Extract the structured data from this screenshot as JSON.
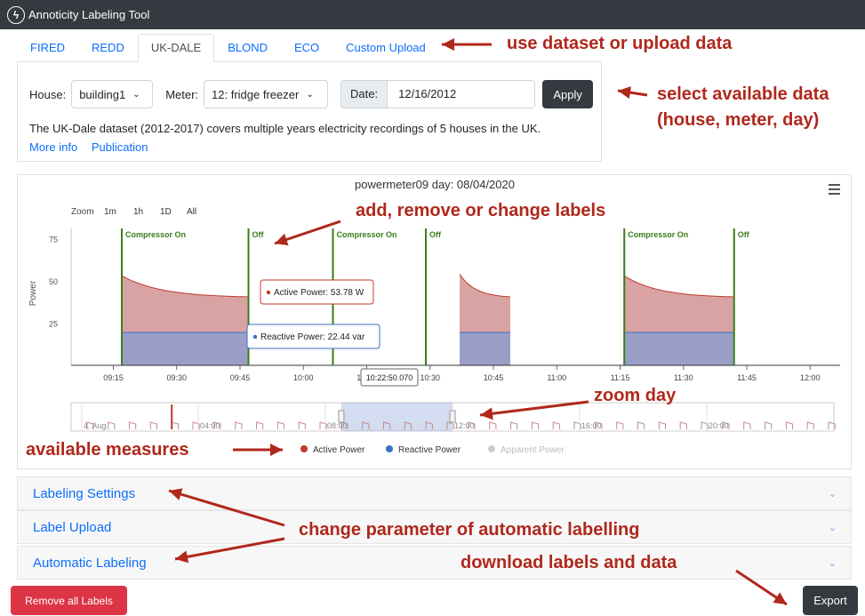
{
  "app": {
    "title": "Annoticity Labeling Tool"
  },
  "tabs": [
    "FIRED",
    "REDD",
    "UK-DALE",
    "BLOND",
    "ECO",
    "Custom Upload"
  ],
  "form": {
    "house_label": "House:",
    "house_value": "building1",
    "meter_label": "Meter:",
    "meter_value": "12: fridge freezer",
    "date_label": "Date:",
    "date_value": "12/16/2012",
    "apply": "Apply",
    "description": "The UK-Dale dataset (2012-2017) covers multiple years electricity recordings of 5 houses in the UK.",
    "more_info": "More info",
    "publication": "Publication"
  },
  "chart_data": {
    "type": "area",
    "title": "powermeter09 day: 08/04/2020",
    "ylabel": "Power",
    "yticks": [
      25,
      50,
      75
    ],
    "ylim": [
      0,
      100
    ],
    "xlim": [
      "09:05",
      "12:05"
    ],
    "xticks": [
      "09:15",
      "09:30",
      "09:45",
      "10:00",
      "10:15",
      "10:30",
      "10:45",
      "11:00",
      "11:15",
      "11:30",
      "11:45",
      "12:00"
    ],
    "zoom_label": "Zoom",
    "zoom_options": [
      "1m",
      "1h",
      "1D",
      "All"
    ],
    "series": [
      {
        "name": "Active Power",
        "color": "#c0392b",
        "fill": "#d9a3a3",
        "unit": "W"
      },
      {
        "name": "Reactive Power",
        "color": "#3b6fc4",
        "fill": "#9a9ec7",
        "unit": "var"
      },
      {
        "name": "Apparent Power",
        "color": "#cccccc",
        "fill": "none",
        "unit": "",
        "disabled": true
      }
    ],
    "cycles": [
      {
        "start": "09:17",
        "end": "09:47",
        "active_peak": 53,
        "active_end": 40,
        "reactive": 19.5
      },
      {
        "start": "10:37",
        "end": "10:49",
        "active_peak": 54,
        "active_end": 40,
        "reactive": 19.5
      },
      {
        "start": "11:16",
        "end": "11:42",
        "active_peak": 53,
        "active_end": 40,
        "reactive": 19.5
      }
    ],
    "labels": [
      {
        "time": "09:17",
        "text": "Compressor On"
      },
      {
        "time": "09:47",
        "text": "Off"
      },
      {
        "time": "10:07",
        "text": "Compressor On"
      },
      {
        "time": "10:29",
        "text": "Off"
      },
      {
        "time": "11:16",
        "text": "Compressor On"
      },
      {
        "time": "11:42",
        "text": "Off"
      }
    ],
    "tooltip_active": "Active Power: 53.78 W",
    "tooltip_reactive": "Reactive Power: 22.44 var",
    "crosshair_time": "10:22:50.070",
    "navigator": {
      "ticks": [
        "4. Aug",
        "04:00",
        "08:00",
        "12:00",
        "16:00",
        "20:00"
      ],
      "selection": [
        "08:30",
        "12:00"
      ]
    },
    "legend_position": "bottom-center"
  },
  "accordion": [
    "Labeling Settings",
    "Label Upload",
    "Automatic Labeling"
  ],
  "buttons": {
    "remove_all": "Remove all Labels",
    "export": "Export"
  },
  "annotations": {
    "dataset": "use dataset or upload data",
    "select_line1": "select available data",
    "select_line2": "(house, meter, day)",
    "labels": "add, remove or change labels",
    "zoom": "zoom day",
    "measures": "available measures",
    "parameter": "change parameter of automatic labelling",
    "download": "download labels and data"
  },
  "colors": {
    "annotation": "#b0281c",
    "label_line": "#3a7d1c",
    "link": "#0d6efd",
    "dark": "#343a40",
    "danger": "#dc3545"
  }
}
